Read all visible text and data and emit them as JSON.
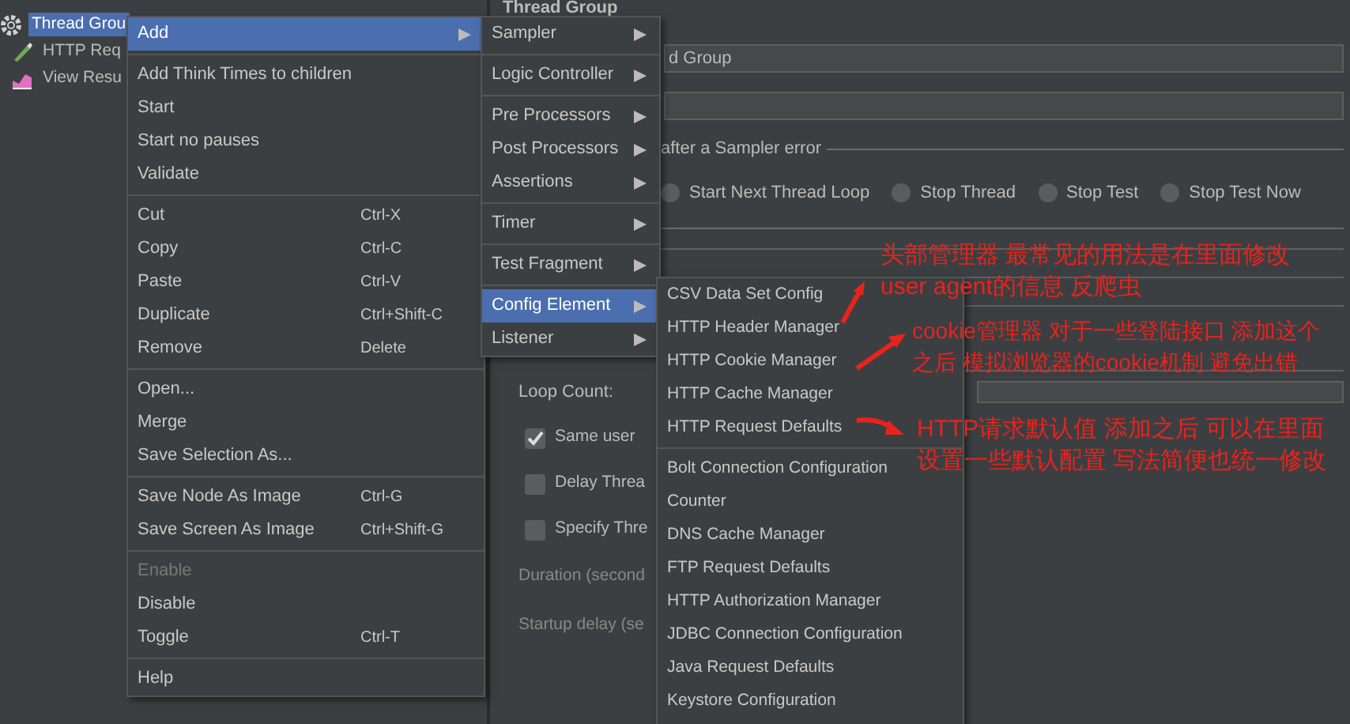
{
  "tree": [
    {
      "label": "Thread Grou",
      "kind": "gear",
      "selected": true,
      "children": [
        {
          "label": "HTTP Req",
          "kind": "pencil",
          "selected": false
        },
        {
          "label": "View Resu",
          "kind": "chart",
          "selected": false
        }
      ]
    }
  ],
  "panel": {
    "title": "Thread Group",
    "name_value": "d Group",
    "error_legend": "after a Sampler error",
    "error_actions": [
      {
        "label": "Start Next Thread Loop",
        "selected": false
      },
      {
        "label": "Stop Thread",
        "selected": false
      },
      {
        "label": "Stop Test",
        "selected": false
      },
      {
        "label": "Stop Test Now",
        "selected": false
      }
    ],
    "loop_label": "Loop Count:",
    "checkboxes": [
      {
        "label": "Same user",
        "checked": true
      },
      {
        "label": "Delay Threa",
        "checked": false
      },
      {
        "label": "Specify Thre",
        "checked": false
      }
    ],
    "disabled_labels": [
      "Duration (second",
      "Startup delay (se"
    ]
  },
  "context_menu": {
    "groups": [
      [
        {
          "label": "Add",
          "submenu": true,
          "selected": true,
          "disabled": false
        }
      ],
      [
        {
          "label": "Add Think Times to children",
          "submenu": false,
          "selected": false,
          "disabled": false
        },
        {
          "label": "Start",
          "submenu": false,
          "selected": false,
          "disabled": false
        },
        {
          "label": "Start no pauses",
          "submenu": false,
          "selected": false,
          "disabled": false
        },
        {
          "label": "Validate",
          "submenu": false,
          "selected": false,
          "disabled": false
        }
      ],
      [
        {
          "label": "Cut",
          "shortcut": "Ctrl-X",
          "submenu": false,
          "selected": false,
          "disabled": false
        },
        {
          "label": "Copy",
          "shortcut": "Ctrl-C",
          "submenu": false,
          "selected": false,
          "disabled": false
        },
        {
          "label": "Paste",
          "shortcut": "Ctrl-V",
          "submenu": false,
          "selected": false,
          "disabled": false
        },
        {
          "label": "Duplicate",
          "shortcut": "Ctrl+Shift-C",
          "submenu": false,
          "selected": false,
          "disabled": false
        },
        {
          "label": "Remove",
          "shortcut": "Delete",
          "submenu": false,
          "selected": false,
          "disabled": false
        }
      ],
      [
        {
          "label": "Open...",
          "submenu": false,
          "selected": false,
          "disabled": false
        },
        {
          "label": "Merge",
          "submenu": false,
          "selected": false,
          "disabled": false
        },
        {
          "label": "Save Selection As...",
          "submenu": false,
          "selected": false,
          "disabled": false
        }
      ],
      [
        {
          "label": "Save Node As Image",
          "shortcut": "Ctrl-G",
          "submenu": false,
          "selected": false,
          "disabled": false
        },
        {
          "label": "Save Screen As Image",
          "shortcut": "Ctrl+Shift-G",
          "submenu": false,
          "selected": false,
          "disabled": false
        }
      ],
      [
        {
          "label": "Enable",
          "submenu": false,
          "selected": false,
          "disabled": true
        },
        {
          "label": "Disable",
          "submenu": false,
          "selected": false,
          "disabled": false
        },
        {
          "label": "Toggle",
          "shortcut": "Ctrl-T",
          "submenu": false,
          "selected": false,
          "disabled": false
        }
      ],
      [
        {
          "label": "Help",
          "submenu": false,
          "selected": false,
          "disabled": false
        }
      ]
    ]
  },
  "add_menu": {
    "groups": [
      [
        {
          "label": "Sampler",
          "submenu": true,
          "selected": false
        }
      ],
      [
        {
          "label": "Logic Controller",
          "submenu": true,
          "selected": false
        }
      ],
      [
        {
          "label": "Pre Processors",
          "submenu": true,
          "selected": false
        },
        {
          "label": "Post Processors",
          "submenu": true,
          "selected": false
        },
        {
          "label": "Assertions",
          "submenu": true,
          "selected": false
        }
      ],
      [
        {
          "label": "Timer",
          "submenu": true,
          "selected": false
        }
      ],
      [
        {
          "label": "Test Fragment",
          "submenu": true,
          "selected": false
        }
      ],
      [
        {
          "label": "Config Element",
          "submenu": true,
          "selected": true
        },
        {
          "label": "Listener",
          "submenu": true,
          "selected": false
        }
      ]
    ]
  },
  "config_menu": {
    "groups": [
      [
        {
          "label": "CSV Data Set Config",
          "submenu": false,
          "selected": false
        },
        {
          "label": "HTTP Header Manager",
          "submenu": false,
          "selected": false
        },
        {
          "label": "HTTP Cookie Manager",
          "submenu": false,
          "selected": false
        },
        {
          "label": "HTTP Cache Manager",
          "submenu": false,
          "selected": false
        },
        {
          "label": "HTTP Request Defaults",
          "submenu": false,
          "selected": false
        }
      ],
      [
        {
          "label": "Bolt Connection Configuration",
          "submenu": false,
          "selected": false
        },
        {
          "label": "Counter",
          "submenu": false,
          "selected": false
        },
        {
          "label": "DNS Cache Manager",
          "submenu": false,
          "selected": false
        },
        {
          "label": "FTP Request Defaults",
          "submenu": false,
          "selected": false
        },
        {
          "label": "HTTP Authorization Manager",
          "submenu": false,
          "selected": false
        },
        {
          "label": "JDBC Connection Configuration",
          "submenu": false,
          "selected": false
        },
        {
          "label": "Java Request Defaults",
          "submenu": false,
          "selected": false
        },
        {
          "label": "Keystore Configuration",
          "submenu": false,
          "selected": false
        }
      ]
    ]
  },
  "annotations": [
    {
      "text": "头部管理器 最常见的用法是在里面修改user agent的信息 反爬虫"
    },
    {
      "text": "cookie管理器 对于一些登陆接口 添加这个之后 模拟浏览器的cookie机制 避免出错"
    },
    {
      "text": "HTTP请求默认值  添加之后 可以在里面设置一些默认配置 写法简便也统一修改"
    }
  ]
}
